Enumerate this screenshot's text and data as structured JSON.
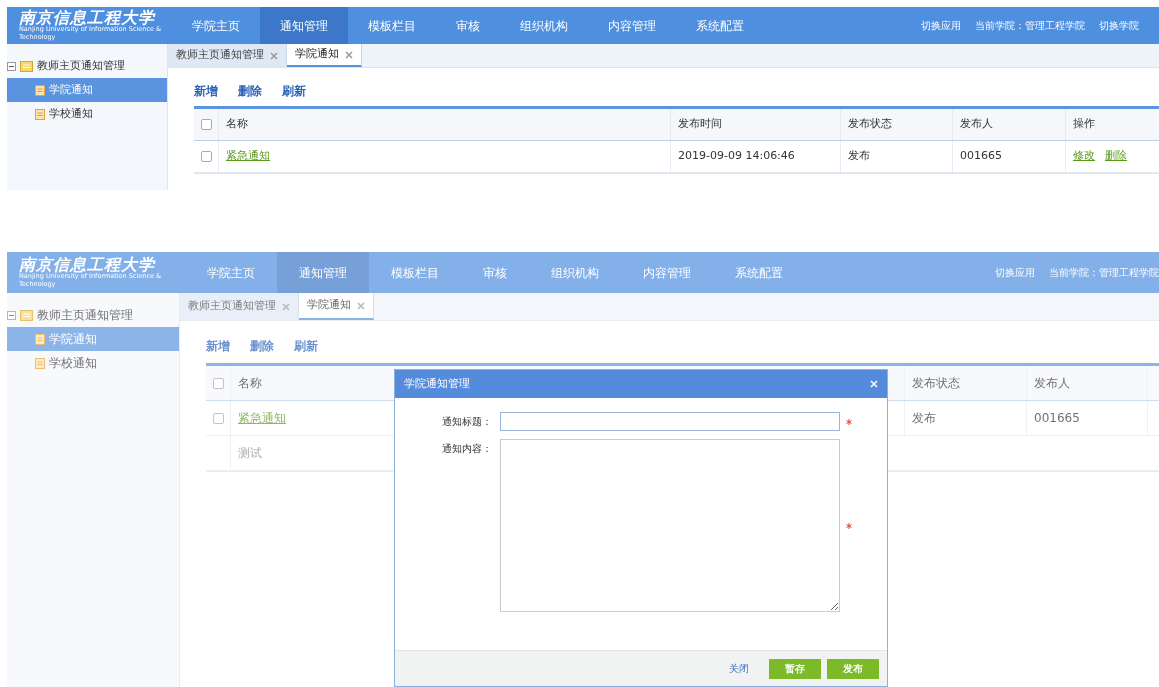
{
  "screens": [
    {
      "header": {
        "logo": "南京信息工程大学",
        "logo_subtitle": "Nanjing University of Information Science & Technology",
        "nav": [
          {
            "label": "学院主页",
            "selected": false
          },
          {
            "label": "通知管理",
            "selected": true
          },
          {
            "label": "模板栏目",
            "selected": false
          },
          {
            "label": "审核",
            "selected": false
          },
          {
            "label": "组织机构",
            "selected": false
          },
          {
            "label": "内容管理",
            "selected": false
          },
          {
            "label": "系统配置",
            "selected": false
          }
        ],
        "right": [
          "切换应用",
          "当前学院：管理工程学院",
          "切换学院"
        ]
      },
      "sidebar": {
        "tree": [
          {
            "label": "教师主页通知管理",
            "expanded": true,
            "selected": false,
            "children": [
              {
                "label": "学院通知",
                "selected": true
              },
              {
                "label": "学校通知",
                "selected": false
              }
            ]
          }
        ]
      },
      "tabs": [
        {
          "label": "教师主页通知管理",
          "selected": false
        },
        {
          "label": "学院通知",
          "selected": true
        }
      ],
      "toolbar": [
        "新增",
        "删除",
        "刷新"
      ],
      "table": {
        "all_checked": false,
        "columns": [
          {
            "label": "名称",
            "kind": "name"
          },
          {
            "label": "发布时间",
            "kind": "time"
          },
          {
            "label": "发布状态",
            "kind": "status"
          },
          {
            "label": "发布人",
            "kind": "user"
          },
          {
            "label": "操作",
            "kind": "actions"
          }
        ],
        "rows": [
          {
            "kind": "link",
            "checked": false,
            "cells": [
              "紧急通知",
              "2019-09-09 14:06:46",
              "发布",
              "001665",
              [
                "修改",
                "删除"
              ]
            ]
          }
        ]
      }
    },
    {
      "header": {
        "logo": "南京信息工程大学",
        "logo_subtitle": "Nanjing University of Information Science & Technology",
        "nav": [
          {
            "label": "学院主页",
            "selected": false
          },
          {
            "label": "通知管理",
            "selected": true
          },
          {
            "label": "模板栏目",
            "selected": false
          },
          {
            "label": "审核",
            "selected": false
          },
          {
            "label": "组织机构",
            "selected": false
          },
          {
            "label": "内容管理",
            "selected": false
          },
          {
            "label": "系统配置",
            "selected": false
          }
        ],
        "right": [
          "切换应用",
          "当前学院：管理工程学院"
        ]
      },
      "sidebar": {
        "tree": [
          {
            "label": "教师主页通知管理",
            "expanded": true,
            "selected": false,
            "children": [
              {
                "label": "学院通知",
                "selected": true
              },
              {
                "label": "学校通知",
                "selected": false
              }
            ]
          }
        ]
      },
      "tabs": [
        {
          "label": "教师主页通知管理",
          "selected": false
        },
        {
          "label": "学院通知",
          "selected": true
        }
      ],
      "toolbar": [
        "新增",
        "删除",
        "刷新"
      ],
      "table": {
        "all_checked": false,
        "columns": [
          {
            "label": "名称",
            "kind": "name"
          },
          {
            "label": "发布状态",
            "kind": "status"
          },
          {
            "label": "发布人",
            "kind": "user"
          },
          {
            "kind": "edge"
          }
        ],
        "rows": [
          {
            "kind": "link",
            "checked": false,
            "cells": [
              "紧急通知",
              "发布",
              "001665"
            ]
          },
          {
            "kind": "plain",
            "cells": [
              "测试"
            ]
          }
        ]
      },
      "dialog": {
        "title": "学院通知管理",
        "fields": [
          {
            "label": "通知标题：",
            "kind": "input",
            "required": true
          },
          {
            "label": "通知内容：",
            "kind": "textarea",
            "required": true
          }
        ],
        "buttons": [
          {
            "label": "关闭",
            "kind": "link"
          },
          {
            "label": "暂存",
            "kind": "primary"
          },
          {
            "label": "发布",
            "kind": "primary"
          }
        ]
      }
    }
  ]
}
